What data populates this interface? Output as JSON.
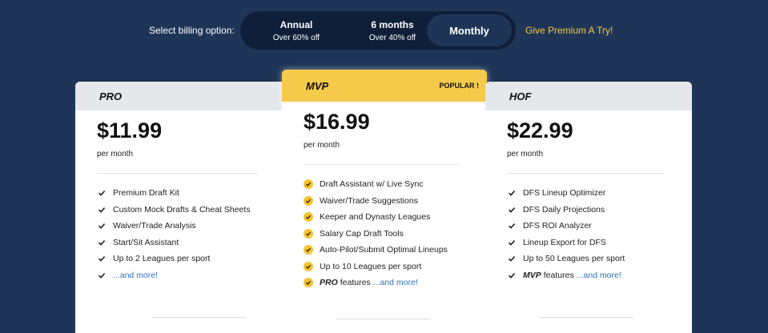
{
  "billing": {
    "label": "Select billing option:",
    "options": [
      {
        "main": "Annual",
        "sub": "Over 60% off"
      },
      {
        "main": "6 months",
        "sub": "Over 40% off"
      },
      {
        "main": "Monthly",
        "sub": ""
      }
    ],
    "selected": "Monthly",
    "premium_link": "Give Premium A Try!"
  },
  "colors": {
    "background": "#1f3557",
    "toggle_bg": "#0f1f3a",
    "accent_yellow": "#f5c94a",
    "link_blue": "#2f6fc0"
  },
  "plans": [
    {
      "name": "PRO",
      "price": "$11.99",
      "period": "per month",
      "features": [
        "Premium Draft Kit",
        "Custom Mock Drafts & Cheat Sheets",
        "Waiver/Trade Analysis",
        "Start/Sit Assistant",
        "Up to 2 Leagues per sport"
      ],
      "more": "...and more!"
    },
    {
      "name": "MVP",
      "badge": "POPULAR !",
      "price": "$16.99",
      "period": "per month",
      "features": [
        "Draft Assistant w/ Live Sync",
        "Waiver/Trade Suggestions",
        "Keeper and Dynasty Leagues",
        "Salary Cap Draft Tools",
        "Auto-Pilot/Submit Optimal Lineups",
        "Up to 10 Leagues per sport"
      ],
      "inherit_tier": "PRO",
      "inherit_text": "features",
      "more": "...and more!"
    },
    {
      "name": "HOF",
      "price": "$22.99",
      "period": "per month",
      "features": [
        "DFS Lineup Optimizer",
        "DFS Daily Projections",
        "DFS ROI Analyzer",
        "Lineup Export for DFS",
        "Up to 50 Leagues per sport"
      ],
      "inherit_tier": "MVP",
      "inherit_text": "features",
      "more": "...and more!"
    }
  ]
}
